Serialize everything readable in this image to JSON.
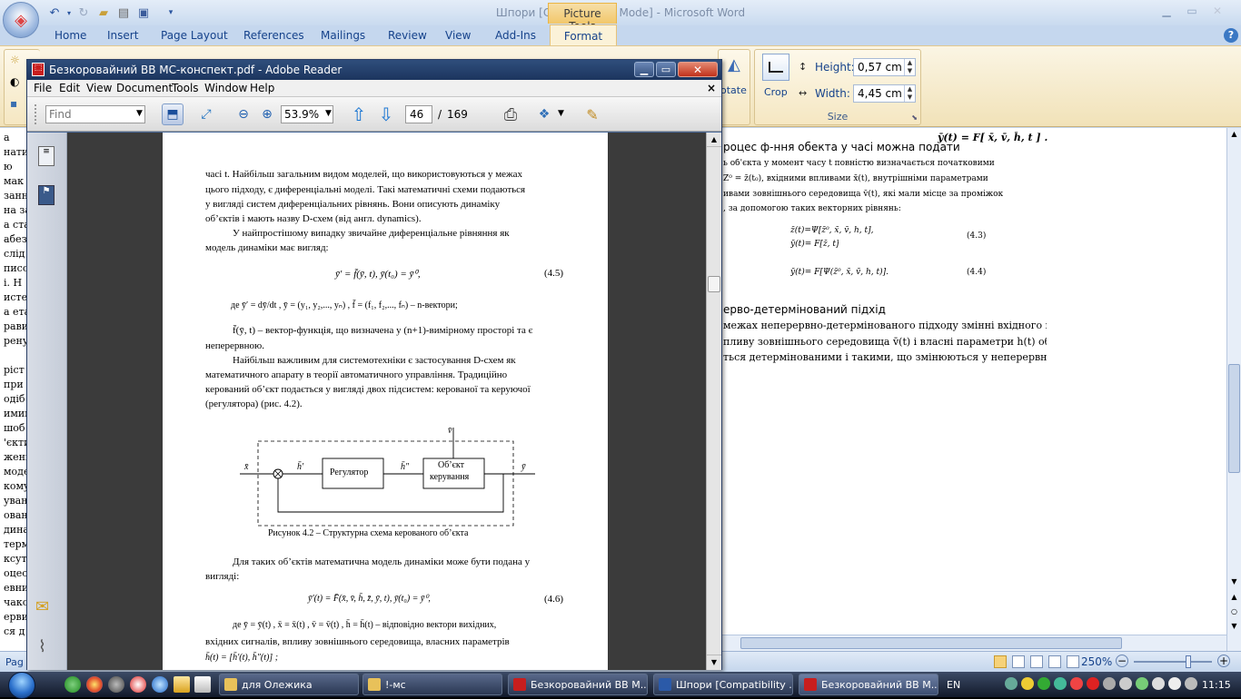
{
  "word": {
    "title": "Шпори [Compatibility Mode] - Microsoft Word",
    "contextual_group": "Picture Tools",
    "tabs": [
      "Home",
      "Insert",
      "Page Layout",
      "References",
      "Mailings",
      "Review",
      "View",
      "Add-Ins"
    ],
    "active_tab": "Format",
    "ribbon": {
      "rotate_label": "otate",
      "crop_label": "Crop",
      "height_label": "Height:",
      "height_value": "0,57 cm",
      "width_label": "Width:",
      "width_value": "4,45 cm",
      "size_group_label": "Size"
    },
    "doc": {
      "formula_top": "ȳ(t) = F[ x̄, v̄, h̄, t ] .",
      "heading1": "роцес ф-ння обекта у часі можна подати",
      "p1": [
        "ь об'єкта у момент часу t повністю визначається початковими",
        "Z̄⁰ = z̄(t₀), вхідними впливами x̄(t), внутрішніми параметрами",
        "ивами зовнішнього середовища v̄(t), які мали місце за проміжок",
        ", за допомогою таких векторних рівнянь:"
      ],
      "eq43_a": "z̄(t)=Ψ[z̄⁰, x̄, v̄, h̄, t],",
      "eq43_b": "ȳ(t)= F[z̄, t]",
      "eq43_num": "(4.3)",
      "eq44": "ȳ(t)= F[Ψ(z̄⁰, x̄, v̄, h̄, t)].",
      "eq44_num": "(4.4)",
      "heading2": "ерво-детермінований підхід",
      "p2": [
        "межах неперервно-детермінованого підходу змінні вхідного впливу",
        "пливу зовнішнього середовища v̄(t) і власні параметри h̄(t) об'єкта",
        "ться детермінованими і такими, що змінюються у неперервному"
      ],
      "left_fragments": [
        "а",
        "натик",
        "ю",
        "мак",
        "занн",
        "на за",
        "а ста",
        "абез",
        "слід",
        "писо",
        "і. Н",
        "исте",
        "а ета",
        "рави",
        "ренун",
        "",
        "ріст",
        "при",
        "одіб",
        "имим.",
        "шоб",
        "'єкти",
        "жені",
        "моде",
        "кому",
        "уван",
        "ован",
        "дина",
        "терм",
        "ксуті",
        "оцес",
        "евни",
        "чако",
        "ерви",
        "ся д"
      ]
    },
    "status": {
      "page_label": "Pag",
      "zoom": "250%"
    }
  },
  "adobe": {
    "title": "Безкоровайний ВВ МС-конспект.pdf - Adobe Reader",
    "menu": [
      "File",
      "Edit",
      "View",
      "Document",
      "Tools",
      "Window",
      "Help"
    ],
    "find_placeholder": "Find",
    "zoom": "53.9%",
    "page_current": "46",
    "page_sep": "/",
    "page_total": "169",
    "page": {
      "para1": [
        "часі  t. Найбільш загальним видом моделей, що використовуються у межах",
        "цього підходу, є диференціальні моделі. Такі математичні схеми подаються",
        "у вигляді систем диференціальних рівнянь. Вони описують динаміку",
        "об’єктів  і мають назву D-схем (від англ. dynamics)."
      ],
      "para2": [
        "У найпростішому випадку звичайне диференціальне рівняння як",
        "модель динаміки має вигляд:"
      ],
      "eq45": "ȳ′ = f̄(ȳ, t),  ȳ(t₀) = ȳ⁰,",
      "eq45_num": "(4.5)",
      "where1": "де  ȳ′ = dȳ/dt ,  ȳ = (y₁, y₂,..., yₙ) ,  f̄ = (f₁, f₂,..., fₙ)  – n-вектори;",
      "para3": [
        "f̄(ȳ, t)  – вектор-функція, що визначена у (n+1)-вимірному просторі та є",
        "неперервною."
      ],
      "para4": [
        "Найбільш важливим для системотехніки є застосування D-схем як",
        "математичного апарату в теорії автоматичного управління. Традиційно",
        "керований об’єкт подається у вигляді двох підсистем: керованої та керуючої",
        "(регулятора) (рис. 4.2)."
      ],
      "diagram": {
        "v_label": "v̄",
        "x_label": "x̄",
        "h1_label": "h̄′",
        "h2_label": "h̄″",
        "y_label": "ȳ",
        "block1": "Регулятор",
        "block2_l1": "Об’єкт",
        "block2_l2": "керування"
      },
      "caption": "Рисунок 4.2 – Структурна схема керованого об’єкта",
      "para5": [
        "Для таких об’єктів математична модель динаміки може бути подана у",
        "вигляді:"
      ],
      "eq46": "ȳ′(t) = F̄(x̄, v̄, h̄, z̄, ȳ, t),  ȳ(t₀) = ȳ⁰,",
      "eq46_num": "(4.6)",
      "para6": [
        "де  ȳ = ȳ(t) , x̄ = x̄(t) , v̄ = v̄(t) , h̄ = h̄(t)  – відповідно вектори вихідних,",
        "вхідних сигналів, впливу зовнішнього середовища, власних параметрів",
        "h̄(t) = [h̄′(t), h̄″(t)] ;"
      ]
    }
  },
  "taskbar": {
    "tasks": [
      "для Олежика",
      "!-мс",
      "Безкоровайний ВВ М...",
      "Шпори [Compatibility ...",
      "Безкоровайний ВВ М..."
    ],
    "lang": "EN",
    "time": "11:15"
  }
}
